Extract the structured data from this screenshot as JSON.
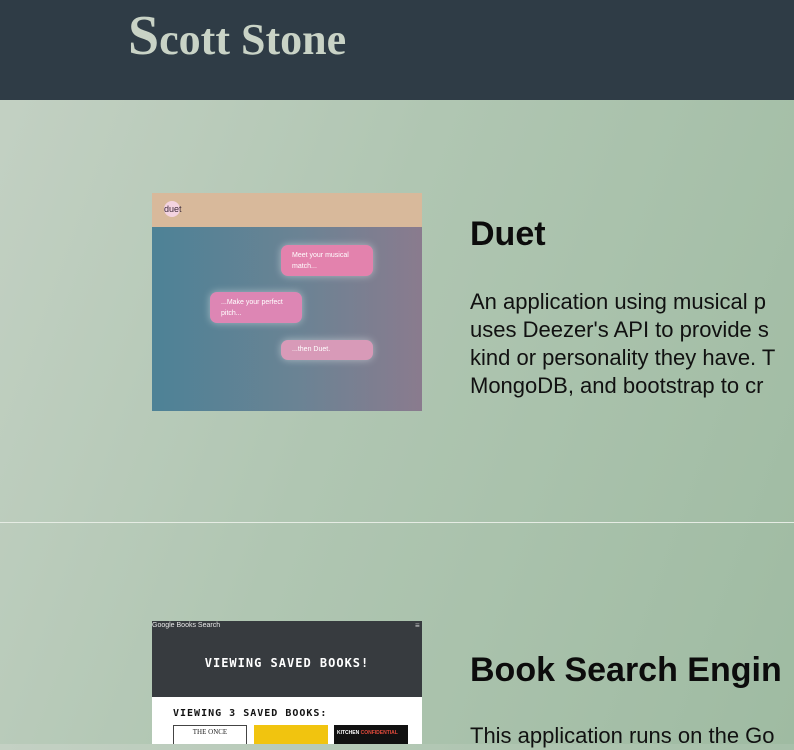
{
  "header": {
    "title_initial": "S",
    "title_rest": "cott Stone"
  },
  "projects": [
    {
      "title": "Duet",
      "description_lines": [
        "An application using musical p",
        "uses Deezer's API to provide s",
        "kind or personality they have. T",
        "MongoDB, and bootstrap to cr"
      ],
      "screenshot": {
        "logo_text": "duet",
        "bubbles": [
          "Meet your musical match...",
          "...Make your perfect pitch...",
          "...then Duet."
        ],
        "colors": {
          "topbar": "#d8b99b",
          "bubble": "#e382ad",
          "background_start": "#4d8296",
          "background_end": "#8a7b8e"
        }
      }
    },
    {
      "title": "Book Search Engin",
      "description_lines": [
        "This application runs on the Go"
      ],
      "screenshot": {
        "mini_title": "Google Books Search",
        "menu_icon": "hamburger-icon",
        "banner": "VIEWING SAVED BOOKS!",
        "subheading": "VIEWING 3 SAVED BOOKS:",
        "covers": [
          {
            "text": "THE ONCE"
          },
          {
            "text": ""
          },
          {
            "text_white": "KITCHEN ",
            "text_red": "CONFIDENTIAL"
          }
        ]
      }
    }
  ]
}
